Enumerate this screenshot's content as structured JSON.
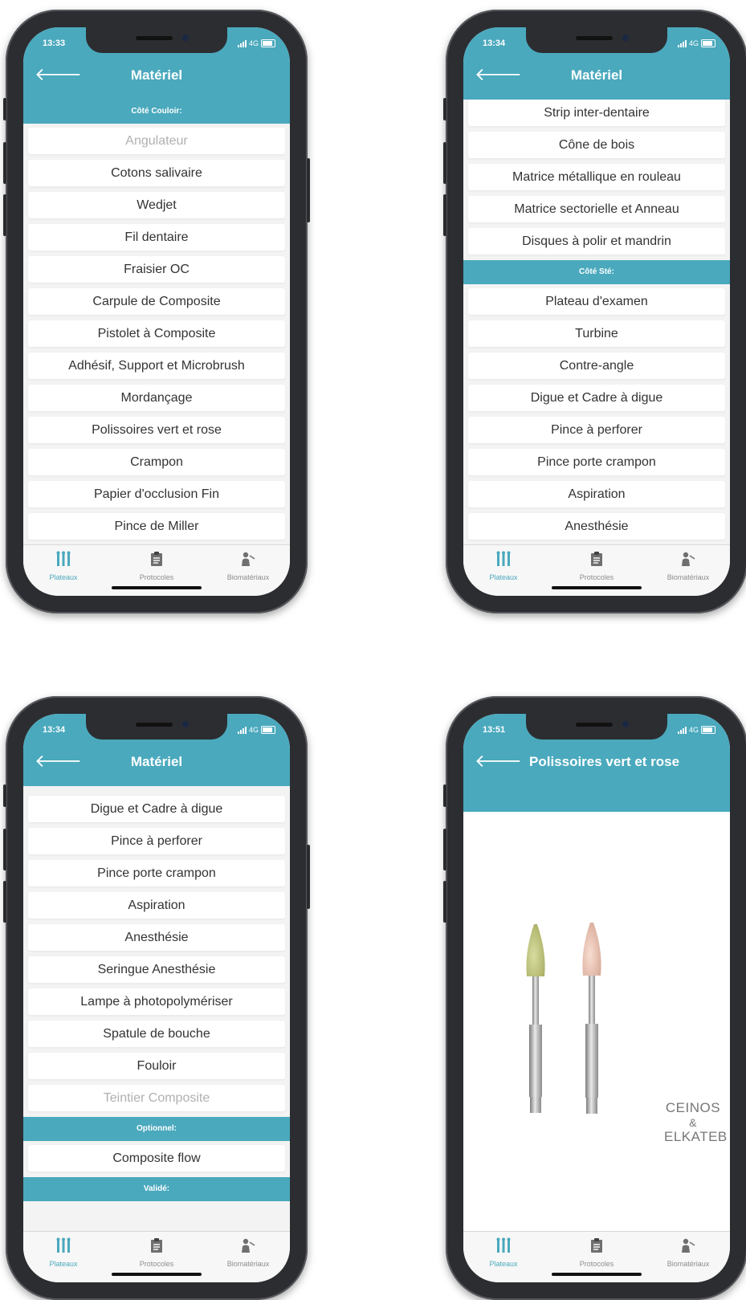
{
  "colors": {
    "accent": "#4aa9bd",
    "item_bg": "#ffffff",
    "list_bg": "#f3f3f3",
    "text": "#333333",
    "dim": "#b0b0b0"
  },
  "tabs": [
    "Plateaux",
    "Protocoles",
    "Biomatériaux"
  ],
  "status_network": "4G",
  "icons": {
    "back": "arrow-left-icon",
    "plateaux": "tools-icon",
    "protocoles": "clipboard-icon",
    "biomateriaux": "dentist-icon"
  },
  "phones": [
    {
      "time": "13:33",
      "title": "Matériel",
      "section": "Côté Couloir:",
      "items": [
        "Angulateur",
        "Cotons salivaire",
        "Wedjet",
        "Fil dentaire",
        "Fraisier OC",
        "Carpule de Composite",
        "Pistolet à Composite",
        "Adhésif, Support et Microbrush",
        "Mordançage",
        "Polissoires vert et rose",
        "Crampon",
        "Papier d'occlusion Fin",
        "Pince de Miller"
      ]
    },
    {
      "time": "13:34",
      "title": "Matériel",
      "items_a": [
        "Strip inter-dentaire",
        "Cône de bois",
        "Matrice métallique en rouleau",
        "Matrice sectorielle et Anneau",
        "Disques à polir et mandrin"
      ],
      "section": "Côté Sté:",
      "items_b": [
        "Plateau d'examen",
        "Turbine",
        "Contre-angle",
        "Digue et Cadre à digue",
        "Pince à perforer",
        "Pince porte crampon",
        "Aspiration",
        "Anesthésie"
      ]
    },
    {
      "time": "13:34",
      "title": "Matériel",
      "items_a": [
        "Digue et Cadre à digue",
        "Pince à perforer",
        "Pince porte crampon",
        "Aspiration",
        "Anesthésie",
        "Seringue Anesthésie",
        "Lampe à photopolymériser",
        "Spatule de bouche",
        "Fouloir",
        "Teintier Composite"
      ],
      "section_optional": "Optionnel:",
      "items_b": [
        "Composite flow"
      ],
      "section_validated": "Validé:"
    },
    {
      "time": "13:51",
      "title": "Polissoires vert et rose",
      "brand_top": "CEINOS",
      "brand_mid": "&",
      "brand_bottom": "ELKATEB"
    }
  ]
}
